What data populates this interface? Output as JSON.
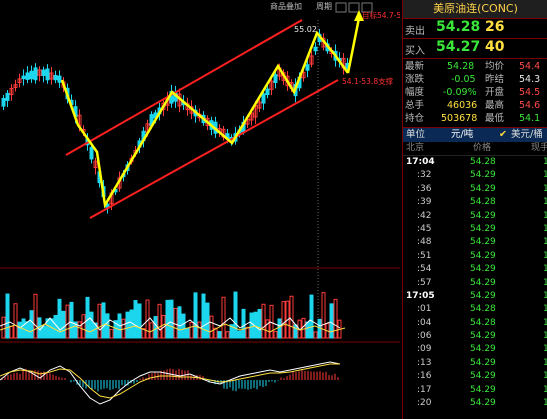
{
  "toolbar": {
    "overlay_label": "商品叠加",
    "cycle_label": "周期"
  },
  "annotations": {
    "peak_label": "55.02",
    "target_label": "目标54.7-55.1",
    "support_label": "54.1-53.8支撑"
  },
  "quote": {
    "title": "美原油连(CONC)",
    "sell": {
      "label": "卖出",
      "price": "54.28",
      "volume": "26"
    },
    "buy": {
      "label": "买入",
      "price": "54.27",
      "volume": "40"
    },
    "stats": [
      {
        "l": "最新",
        "v": "54.28",
        "vc": "g",
        "l2": "均价",
        "v2": "54.4",
        "v2c": "r"
      },
      {
        "l": "涨跌",
        "v": "-0.05",
        "vc": "g",
        "l2": "昨结",
        "v2": "54.3",
        "v2c": "w"
      },
      {
        "l": "幅度",
        "v": "-0.09%",
        "vc": "g",
        "l2": "开盘",
        "v2": "54.5",
        "v2c": "r"
      },
      {
        "l": "总手",
        "v": "46036",
        "vc": "y",
        "l2": "最高",
        "v2": "54.6",
        "v2c": "r"
      },
      {
        "l": "持仓",
        "v": "503678",
        "vc": "y",
        "l2": "最低",
        "v2": "54.1",
        "v2c": "g"
      }
    ],
    "unit": {
      "label": "单位",
      "value": "元/吨",
      "option": "美元/桶"
    },
    "columns": {
      "city": "北京",
      "price": "价格",
      "current": "现手"
    },
    "ticks": [
      {
        "time": "17:04",
        "price": "54.28",
        "strong": true
      },
      {
        "time": ":32",
        "price": "54.29"
      },
      {
        "time": ":36",
        "price": "54.29"
      },
      {
        "time": ":39",
        "price": "54.28"
      },
      {
        "time": ":42",
        "price": "54.29"
      },
      {
        "time": ":45",
        "price": "54.29"
      },
      {
        "time": ":48",
        "price": "54.29"
      },
      {
        "time": ":51",
        "price": "54.29"
      },
      {
        "time": ":54",
        "price": "54.29"
      },
      {
        "time": ":57",
        "price": "54.29"
      },
      {
        "time": "17:05",
        "price": "54.29",
        "strong": true
      },
      {
        "time": ":01",
        "price": "54.28"
      },
      {
        "time": ":04",
        "price": "54.28"
      },
      {
        "time": ":06",
        "price": "54.29"
      },
      {
        "time": ":09",
        "price": "54.29"
      },
      {
        "time": ":13",
        "price": "54.29"
      },
      {
        "time": ":16",
        "price": "54.29"
      },
      {
        "time": ":17",
        "price": "54.29"
      },
      {
        "time": ":20",
        "price": "54.29"
      }
    ]
  },
  "colors": {
    "up": "#ff3b3b",
    "down": "#1cd6ee",
    "channel": "#ff2020",
    "arrow": "#ffff00"
  }
}
